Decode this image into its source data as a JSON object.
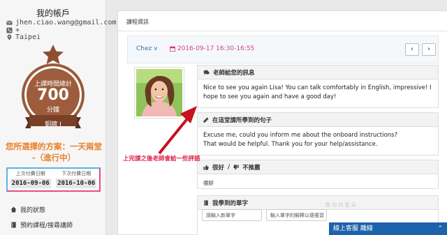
{
  "account": {
    "title": "我的帳戶",
    "email": "jhen.ciao.wang@gmail.com",
    "phone": "+",
    "city": "Taipei"
  },
  "medal": {
    "total_label": "上課時間總計",
    "minutes": "700",
    "unit": "分鐘",
    "rank": "銅牌 I"
  },
  "plan": {
    "line1": "您所選擇的方案：一天兩堂",
    "line2": "-（進行中）"
  },
  "payment": {
    "last_label": "上次付費日期",
    "last_value": "2016-09-06",
    "next_label": "下次付費日期",
    "next_value": "2016-10-06"
  },
  "sidebar_links": {
    "status": "我的狀態",
    "book": "預約課程/搜尋講師"
  },
  "main": {
    "section_title": "課程資訊",
    "teacher": "Chez v",
    "date": "2016-09-17 16:30-16:55",
    "prev": "‹",
    "next": "›"
  },
  "panels": {
    "message_title": "老師給您的訊息",
    "message_body": "Nice to see you again Lisa! You can talk comfortably in English, impressive! I hope to see you again and have a good day!",
    "learned_title": "在這堂課所學到的句子",
    "learned_line1": "Excuse me, could you inform me about the onboard instructions?",
    "learned_line2": "That would be helpful. Thank you for your help/assistance.",
    "rating_title_like": "很好",
    "rating_title_sep": "/",
    "rating_title_dislike": "不推薦",
    "rating_body": "很好",
    "vocab_title": "我學到的單字",
    "vocab_input_placeholder": "請輸入新單字",
    "vocab_meaning_placeholder": "輸入單字的解釋以便複習"
  },
  "annotation": "上完課之後老師會給一些評語",
  "watermark": "飄 泊 的 雲 朵",
  "chat": {
    "label": "線上客服 離線",
    "caret": "⌃"
  },
  "colors": {
    "medal": "#9a5a3a",
    "accent_blue": "#2d6fa8",
    "date_pink": "#d43f8d",
    "plan_orange": "#e8822a",
    "chat_blue": "#1d62ad",
    "annotation_red": "#e0214a"
  }
}
